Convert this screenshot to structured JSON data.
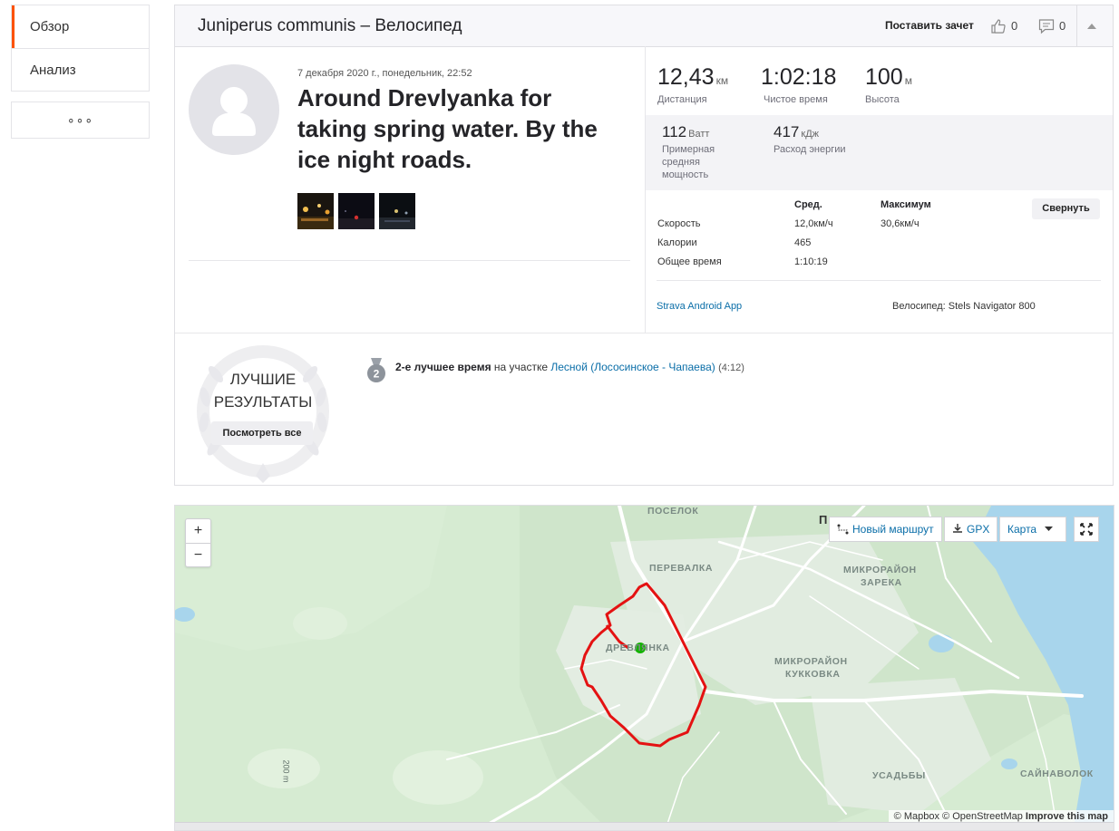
{
  "nav": {
    "items": [
      {
        "label": "Обзор",
        "active": true
      },
      {
        "label": "Анализ",
        "active": false
      }
    ],
    "more_label": "∘∘∘"
  },
  "header": {
    "title": "Juniperus communis – Велосипед",
    "kudos_label": "Поставить зачет",
    "kudos_count": "0",
    "comments_count": "0"
  },
  "activity": {
    "date": "7 декабря 2020 г., понедельник, 22:52",
    "name": "Around Drevlyanka for taking spring water. By the ice night roads.",
    "photo_count": 3
  },
  "stats": {
    "distance": {
      "value": "12,43",
      "unit": "км",
      "label": "Дистанция"
    },
    "moving_time": {
      "value": "1:02:18",
      "label": "Чистое время"
    },
    "elevation": {
      "value": "100",
      "unit": "м",
      "label": "Высота"
    },
    "power": {
      "value": "112",
      "unit": "Ватт",
      "label": "Примерная средняя мощность"
    },
    "energy": {
      "value": "417",
      "unit": "кДж",
      "label": "Расход энергии"
    }
  },
  "table": {
    "col_avg": "Сред.",
    "col_max": "Максимум",
    "collapse_label": "Свернуть",
    "rows": [
      {
        "label": "Скорость",
        "avg": "12,0км/ч",
        "max": "30,6км/ч"
      },
      {
        "label": "Калории",
        "avg": "465",
        "max": ""
      },
      {
        "label": "Общее время",
        "avg": "1:10:19",
        "max": ""
      }
    ]
  },
  "device": {
    "app": "Strava Android App",
    "bike": "Велосипед: Stels Navigator 800"
  },
  "best": {
    "title_line1": "ЛУЧШИЕ",
    "title_line2": "РЕЗУЛЬТАТЫ",
    "see_all": "Посмотреть все",
    "medal_rank": "2",
    "effort_bold": "2-е лучшее время",
    "effort_text": " на участке ",
    "segment": "Лесной (Лососинское - Чапаева)",
    "segment_time": "(4:12)"
  },
  "map": {
    "zoom_in": "+",
    "zoom_out": "−",
    "new_route": "Новый маршрут",
    "gpx": "GPX",
    "map_type": "Карта",
    "labels": {
      "poselok": "ПОСЕЛОК",
      "perevalka": "ПЕРЕВАЛКА",
      "mkr_zareka_1": "МИКРОРАЙОН",
      "mkr_zareka_2": "ЗАРЕКА",
      "drevlyanka": "ДРЕВЛЯНКА",
      "mkr_kukkovka_1": "МИКРОРАЙОН",
      "mkr_kukkovka_2": "КУККОВКА",
      "usadby": "УСАДЬБЫ",
      "saynavolok": "САЙНАВОЛОК",
      "p_letter": "П"
    },
    "scale": "200 m",
    "attrib_mapbox": "© Mapbox",
    "attrib_osm": "© OpenStreetMap",
    "attrib_improve": "Improve this map"
  },
  "colors": {
    "accent": "#fc5200",
    "link": "#0a6ea8",
    "route": "#e41212",
    "start": "#13b200",
    "water": "#a8d5ec",
    "land": "#d6ebd2"
  }
}
